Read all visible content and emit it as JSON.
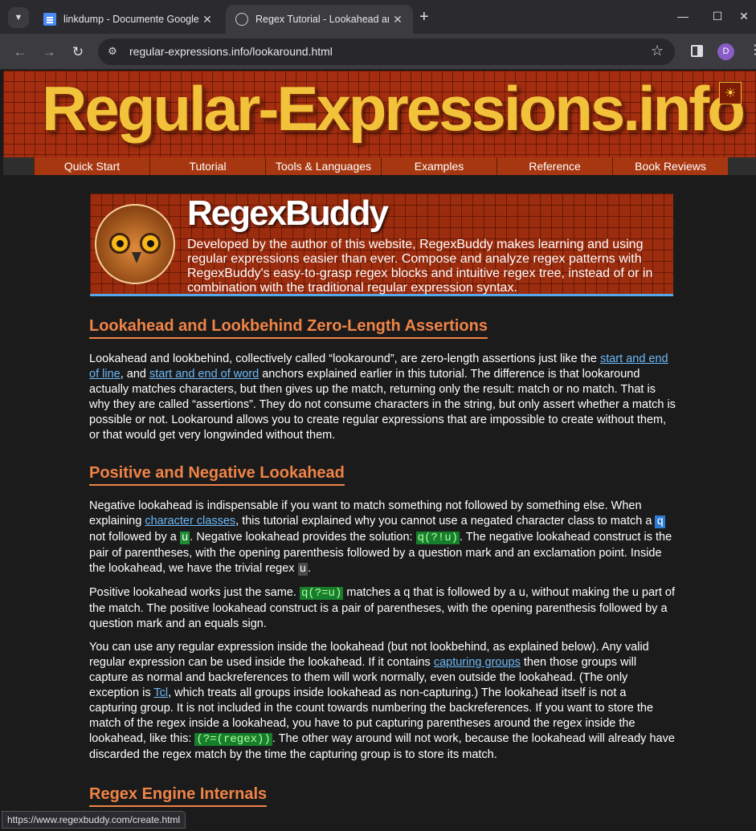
{
  "browser": {
    "tabs": [
      {
        "title": "linkdump - Documente Google",
        "active": false
      },
      {
        "title": "Regex Tutorial - Lookahead and Lookbehind Zero-Length Assertions",
        "active": true
      }
    ],
    "url": "regular-expressions.info/lookaround.html",
    "profile_initial": "D",
    "status_url": "https://www.regexbuddy.com/create.html"
  },
  "site": {
    "title": "Regular-Expressions.info",
    "nav": [
      "Quick Start",
      "Tutorial",
      "Tools & Languages",
      "Examples",
      "Reference",
      "Book Reviews"
    ]
  },
  "ad": {
    "title": "RegexBuddy",
    "text": "Developed by the author of this website, RegexBuddy makes learning and using regular expressions easier than ever.  Compose and analyze regex patterns with RegexBuddy's easy-to-grasp regex blocks and intuitive regex tree, instead of or in combination with the traditional regular expression syntax."
  },
  "article": {
    "h1": "Lookahead and Lookbehind Zero-Length Assertions",
    "p1": {
      "t1": "Lookahead and lookbehind, collectively called “lookaround”, are zero-length assertions just like the ",
      "link1": "start and end of line",
      "t2": ", and ",
      "link2": "start and end of word",
      "t3": " anchors explained earlier in this tutorial. The difference is that lookaround actually matches characters, but then gives up the match, returning only the result: match or no match. That is why they are called “assertions”. They do not consume characters in the string, but only assert whether a match is possible or not. Lookaround allows you to create regular expressions that are impossible to create without them, or that would get very longwinded without them."
    },
    "h2": "Positive and Negative Lookahead",
    "p2": {
      "t1": "Negative lookahead is indispensable if you want to match something not followed by something else. When explaining ",
      "link1": "character classes",
      "t2": ", this tutorial explained why you cannot use a negated character class to match a ",
      "code_q": "q",
      "t3": " not followed by a ",
      "code_u": "u",
      "t4": ". Negative lookahead provides the solution: ",
      "code_neg": "q(?!u)",
      "t5": ". The negative lookahead construct is the pair of parentheses, with the opening parenthesis followed by a question mark and an exclamation point. Inside the lookahead, we have the trivial regex ",
      "code_u2": "u",
      "t6": "."
    },
    "p3": {
      "t0": "Positive lookahead works just the same. ",
      "code_pos": "q(?=u)",
      "t1": " matches a q that is followed by a u, without making the u part of the match. The positive lookahead construct is a pair of parentheses, with the opening parenthesis followed by a question mark and an equals sign."
    },
    "p4": {
      "t1": "You can use any regular expression inside the lookahead (but not lookbehind, as explained below). Any valid regular expression can be used inside the lookahead. If it contains ",
      "link1": "capturing groups",
      "t2": " then those groups will capture as normal and backreferences to them will work normally, even outside the lookahead. (The only exception is ",
      "link2": "Tcl",
      "t3": ", which treats all groups inside lookahead as non-capturing.) The lookahead itself is not a capturing group. It is not included in the count towards numbering the backreferences. If you want to store the match of the regex inside a lookahead, you have to put capturing parentheses around the regex inside the lookahead, like this: ",
      "code_cap": "(?=(regex))",
      "t4": ". The other way around will not work, because the lookahead will already have discarded the regex match by the time the capturing group is to store its match."
    },
    "h3": "Regex Engine Internals"
  }
}
